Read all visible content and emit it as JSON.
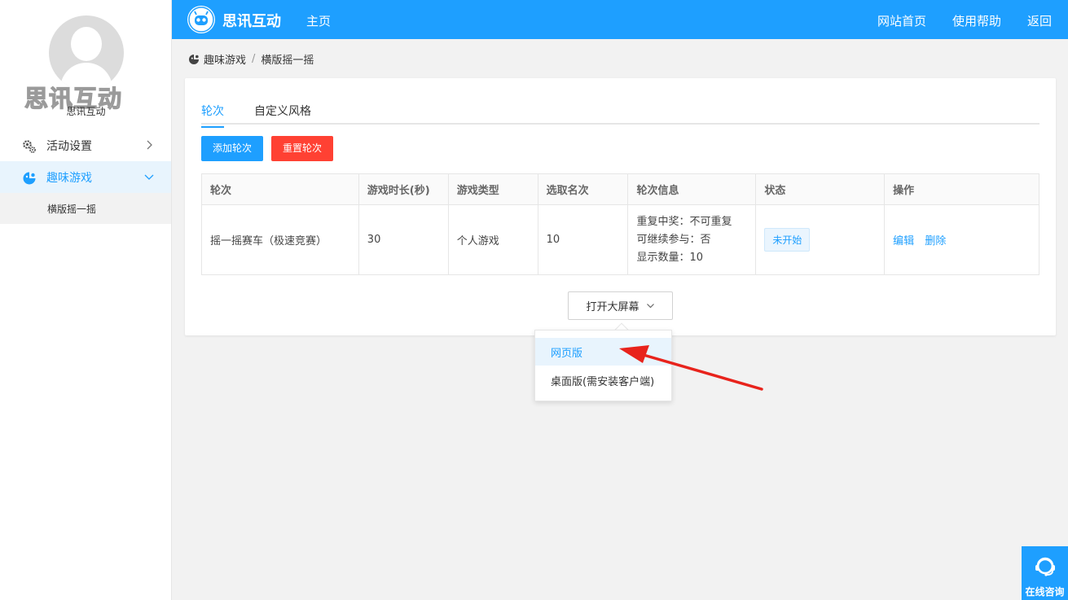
{
  "sidebar": {
    "brand_watermark": "思讯互动",
    "brand_name": "思讯互动",
    "items": [
      {
        "label": "活动设置",
        "icon": "gears-icon"
      },
      {
        "label": "趣味游戏",
        "icon": "game-icon"
      }
    ],
    "sub_item": "横版摇一摇"
  },
  "header": {
    "logo_text": "思讯互动",
    "home": "主页",
    "right_links": [
      "网站首页",
      "使用帮助",
      "返回"
    ]
  },
  "breadcrumb": [
    "趣味游戏",
    "横版摇一摇"
  ],
  "tabs": [
    "轮次",
    "自定义风格"
  ],
  "buttons": {
    "add": "添加轮次",
    "reset": "重置轮次",
    "open": "打开大屏幕"
  },
  "table": {
    "headers": [
      "轮次",
      "游戏时长(秒)",
      "游戏类型",
      "选取名次",
      "轮次信息",
      "状态",
      "操作"
    ],
    "row": {
      "round": "摇一摇赛车（极速竞赛）",
      "duration": "30",
      "type": "个人游戏",
      "rank": "10",
      "info": [
        "重复中奖：不可重复",
        "可继续参与：否",
        "显示数量：10"
      ],
      "status": "未开始",
      "ops": [
        "编辑",
        "删除"
      ]
    }
  },
  "dropdown": [
    "网页版",
    "桌面版(需安装客户端)"
  ],
  "float_help": "在线咨询",
  "colors": {
    "primary": "#1e9fff",
    "danger": "#ff4133",
    "annotation": "#e8231c"
  }
}
